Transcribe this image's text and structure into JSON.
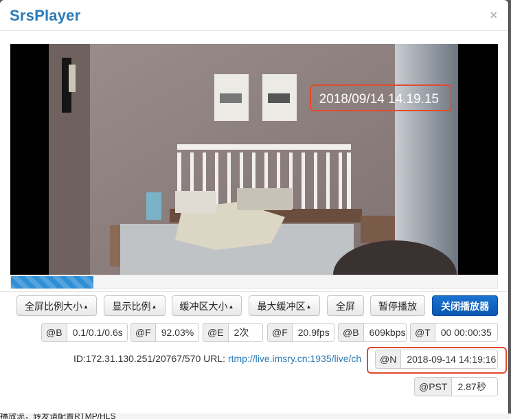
{
  "app": {
    "title": "SrsPlayer",
    "close_glyph": "×"
  },
  "video": {
    "overlay_timestamp": "2018/09/14 14.19.15",
    "progress_percent": 17
  },
  "toolbar": {
    "fullscreen_ratio": "全屏比例大小",
    "display_ratio": "显示比例",
    "buffer_size": "缓冲区大小",
    "max_buffer": "最大缓冲区",
    "fullscreen": "全屏",
    "pause": "暂停播放",
    "close_player": "关闭播放器"
  },
  "stats": [
    {
      "addon": "@B",
      "value": "0.1/0.1/0.6s"
    },
    {
      "addon": "@F",
      "value": "92.03%"
    },
    {
      "addon": "@E",
      "value": "2次"
    },
    {
      "addon": "@F",
      "value": "20.9fps"
    },
    {
      "addon": "@B",
      "value": "609kbps"
    },
    {
      "addon": "@T",
      "value": "00 00:00:35"
    }
  ],
  "info": {
    "id_text": "ID:172.31.130.251/20767/570 URL: ",
    "url": "rtmp://live.imsry.cn:1935/live/ch"
  },
  "ntp": {
    "addon": "@N",
    "value": "2018-09-14 14:19:16"
  },
  "pst": {
    "addon": "@PST",
    "value": "2.87秒"
  },
  "bottom_text": "播放流，转发请配置RTMP/HLS",
  "colors": {
    "accent": "#2a7ab8",
    "primary": "#0a57b0",
    "highlight": "#e24a2e"
  }
}
